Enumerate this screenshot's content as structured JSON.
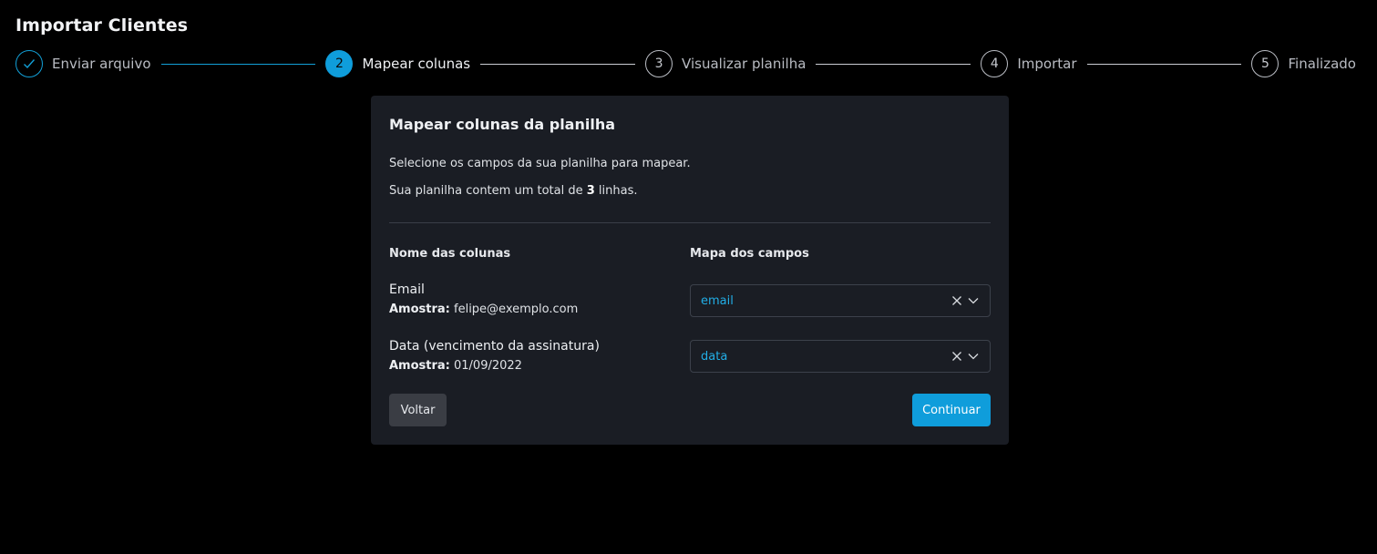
{
  "page": {
    "title": "Importar Clientes"
  },
  "stepper": {
    "steps": [
      {
        "number": "",
        "label": "Enviar arquivo",
        "state": "done"
      },
      {
        "number": "2",
        "label": "Mapear colunas",
        "state": "active"
      },
      {
        "number": "3",
        "label": "Visualizar planilha",
        "state": "pending"
      },
      {
        "number": "4",
        "label": "Importar",
        "state": "pending"
      },
      {
        "number": "5",
        "label": "Finalizado",
        "state": "pending"
      }
    ]
  },
  "card": {
    "title": "Mapear colunas da planilha",
    "description": "Selecione os campos da sua planilha para mapear.",
    "total_prefix": "Sua planilha contem um total de ",
    "total_count": "3",
    "total_suffix": " linhas.",
    "column_header_left": "Nome das colunas",
    "column_header_right": "Mapa dos campos",
    "sample_label": "Amostra:",
    "rows": [
      {
        "name": "Email",
        "sample": " felipe@exemplo.com",
        "mapped": "email"
      },
      {
        "name": "Data (vencimento da assinatura)",
        "sample": " 01/09/2022",
        "mapped": "data"
      }
    ],
    "back_label": "Voltar",
    "continue_label": "Continuar"
  },
  "colors": {
    "accent": "#0f9ddb",
    "background": "#000000",
    "card": "#1a1d24"
  },
  "icons": {
    "done_step": "check-icon",
    "clear": "close-icon",
    "dropdown": "chevron-down-icon"
  }
}
